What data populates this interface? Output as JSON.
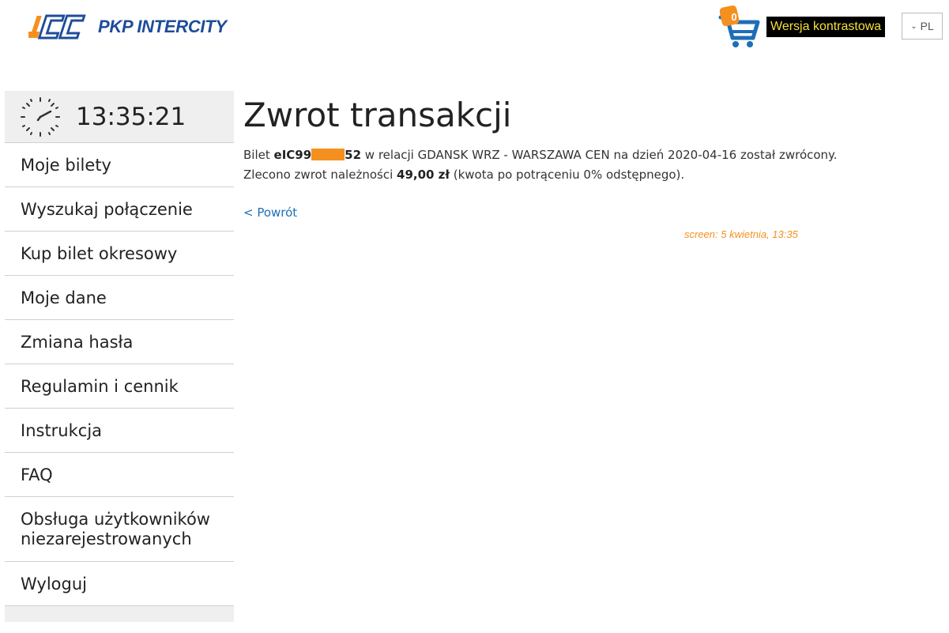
{
  "header": {
    "logo_text": "PKP INTERCITY",
    "logo_mark_text": "ICC",
    "cart_count": "0",
    "contrast_label": "Wersja kontrastowa",
    "language": "PL"
  },
  "sidebar": {
    "clock_time": "13:35:21",
    "items": [
      {
        "label": "Moje bilety"
      },
      {
        "label": "Wyszukaj połączenie"
      },
      {
        "label": "Kup bilet okresowy"
      },
      {
        "label": "Moje dane"
      },
      {
        "label": "Zmiana hasła"
      },
      {
        "label": "Regulamin i cennik"
      },
      {
        "label": "Instrukcja"
      },
      {
        "label": "FAQ"
      },
      {
        "label": "Obsługa użytkowników niezarejestrowanych"
      },
      {
        "label": "Wyloguj"
      }
    ]
  },
  "main": {
    "title": "Zwrot transakcji",
    "line1": {
      "prefix": "Bilet ",
      "ticket_start": "eIC99",
      "ticket_end": "52",
      "rest": " w relacji GDANSK WRZ - WARSZAWA CEN na dzień 2020-04-16 został zwrócony."
    },
    "line2": {
      "prefix": "Zlecono zwrot należności ",
      "amount": "49,00 zł",
      "rest": " (kwota po potrąceniu 0% odstępnego)."
    },
    "back_link": "< Powrót"
  },
  "screen_note": "screen: 5 kwietnia, 13:35",
  "colors": {
    "accent_orange": "#f5901e",
    "brand_blue": "#1e4c9a",
    "link_blue": "#1e6eb8",
    "contrast_bg": "#000000",
    "contrast_text": "#f2e03c"
  },
  "icons": {
    "logo": "intercity-logo-icon",
    "cart": "shopping-cart-icon",
    "clock": "clock-icon",
    "language_chevron": "chevron-down-icon"
  }
}
